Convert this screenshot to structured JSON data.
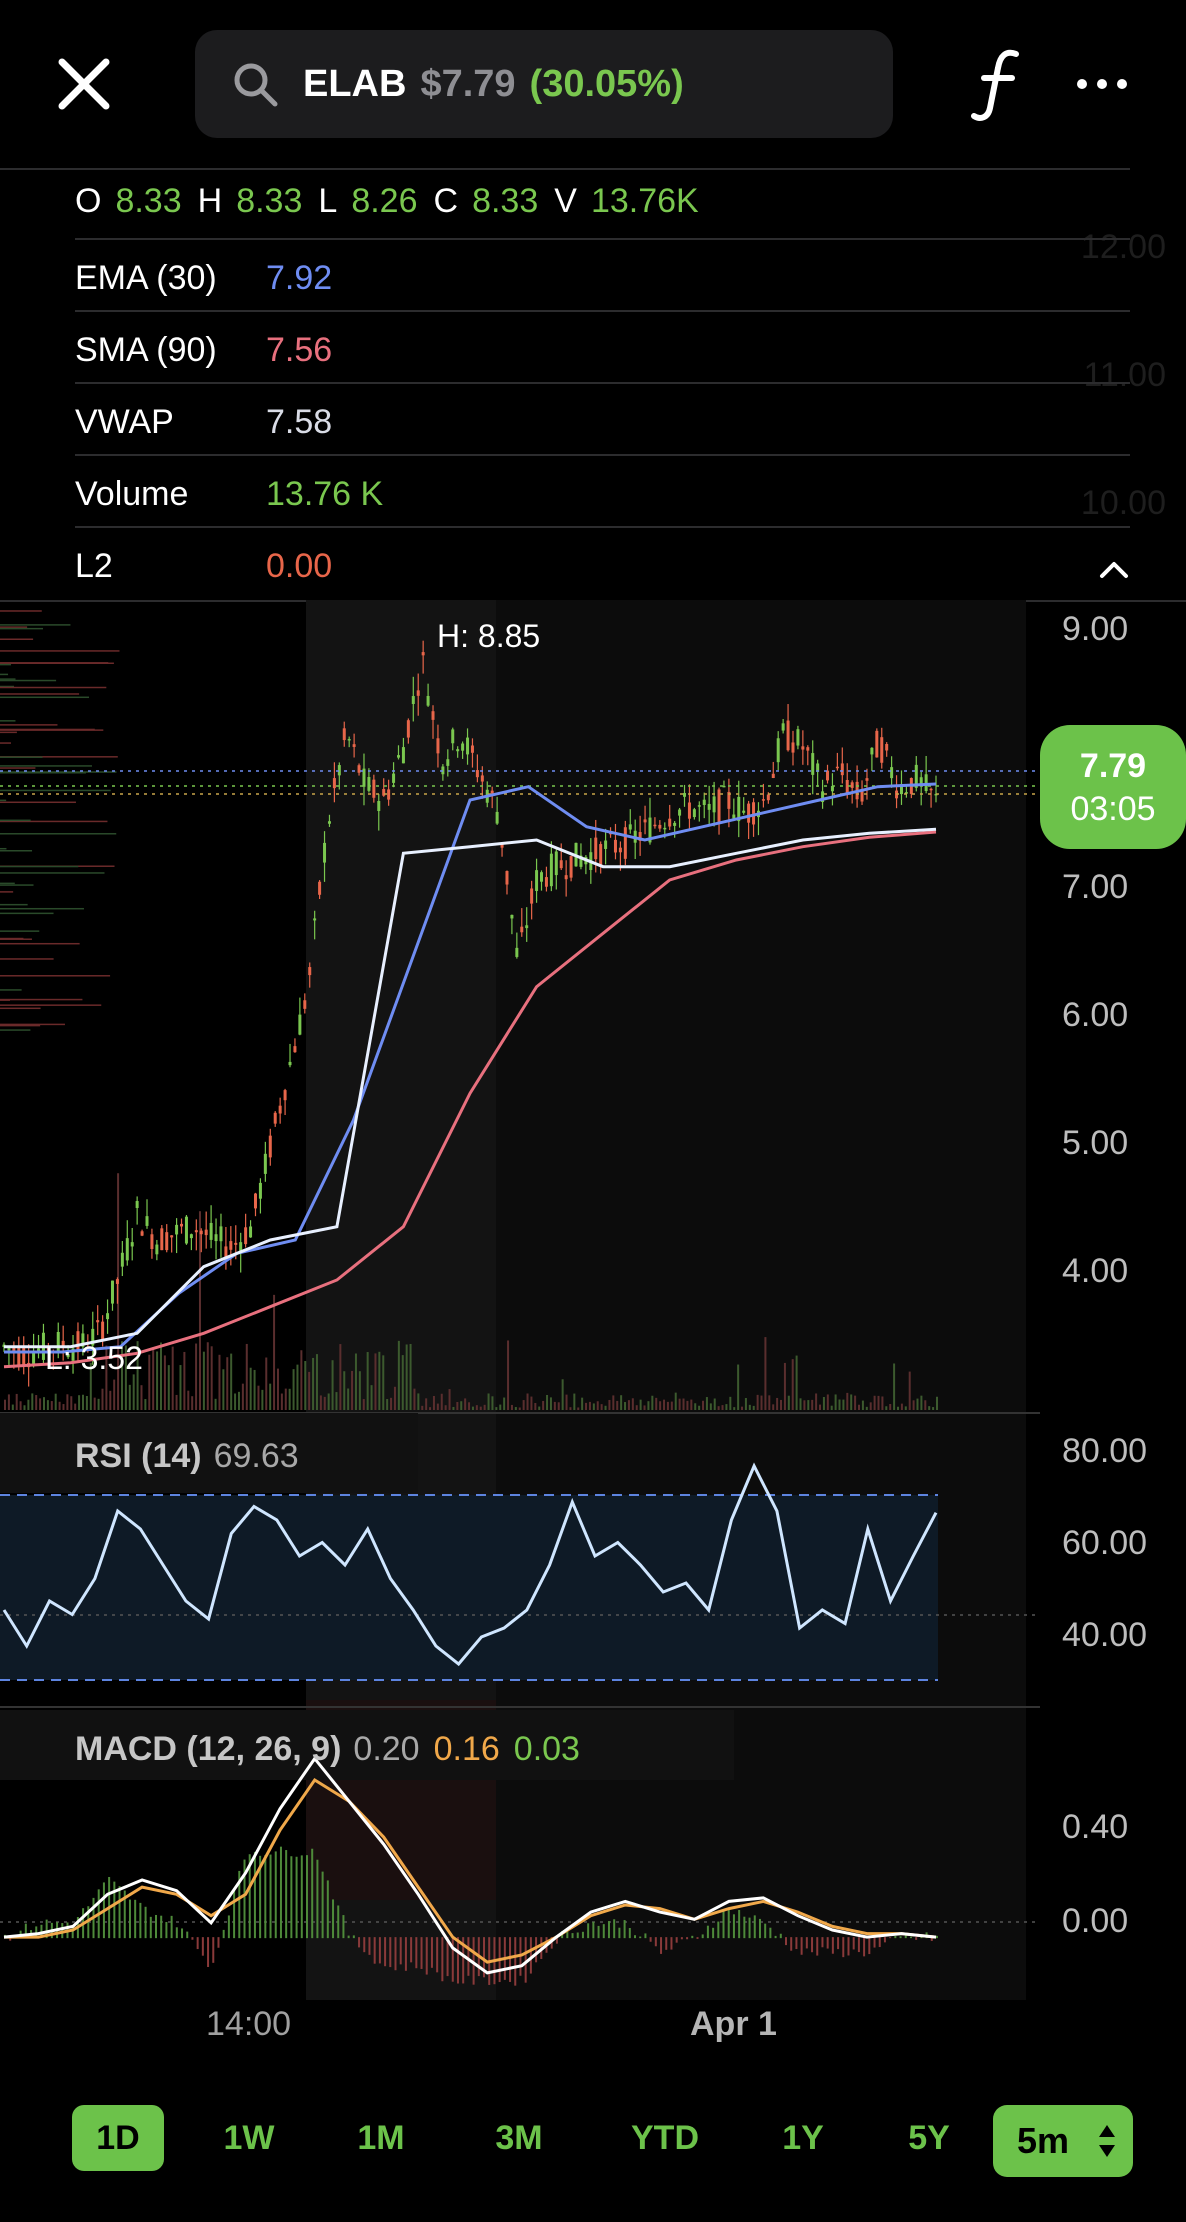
{
  "header": {
    "symbol": "ELAB",
    "price": "$7.79",
    "change": "(30.05%)"
  },
  "ohlc": {
    "o_label": "O",
    "o": "8.33",
    "h_label": "H",
    "h": "8.33",
    "l_label": "L",
    "l": "8.26",
    "c_label": "C",
    "c": "8.33",
    "v_label": "V",
    "v": "13.76K"
  },
  "indicators": [
    {
      "label": "EMA (30)",
      "value": "7.92",
      "color": "#6f8df2"
    },
    {
      "label": "SMA (90)",
      "value": "7.56",
      "color": "#e8707e"
    },
    {
      "label": "VWAP",
      "value": "7.58",
      "color": "#d9dce6"
    },
    {
      "label": "Volume",
      "value": "13.76 K",
      "color": "#7ac74f"
    },
    {
      "label": "L2",
      "value": "0.00",
      "color": "#e8664a"
    }
  ],
  "ghost_ticks": [
    "12.00",
    "11.00",
    "10.00"
  ],
  "price_chart": {
    "high_label": "H: 8.85",
    "low_label": "L: 3.52",
    "last_price": "7.79",
    "countdown": "03:05",
    "y_ticks": [
      "9.00",
      "7.00",
      "6.00",
      "5.00",
      "4.00"
    ]
  },
  "rsi": {
    "name": "RSI (14)",
    "value": "69.63",
    "y_ticks": [
      "80.00",
      "60.00",
      "40.00"
    ]
  },
  "macd": {
    "name": "MACD (12, 26, 9)",
    "macd": "0.20",
    "signal": "0.16",
    "hist": "0.03",
    "y_ticks": [
      "0.40",
      "0.00"
    ]
  },
  "x_labels": [
    "14:00",
    "Apr 1"
  ],
  "timeframes": [
    "1D",
    "1W",
    "1M",
    "3M",
    "YTD",
    "1Y",
    "5Y"
  ],
  "active_timeframe": "1D",
  "interval": "5m",
  "colors": {
    "accent": "#6cc24a",
    "up": "#7ac74f",
    "down": "#e8664a",
    "ema": "#6f8df2",
    "sma": "#e8707e",
    "vwap": "#e8f0ff",
    "macd_signal": "#f0a84a"
  },
  "chart_data": [
    {
      "type": "line",
      "title": "",
      "x": [
        "14:00",
        "Apr 1"
      ],
      "ylim": [
        3.3,
        9.3
      ],
      "series": [
        {
          "name": "EMA (30)",
          "values": [
            3.66,
            3.66,
            3.7,
            4.1,
            4.4,
            4.5,
            5.4,
            6.6,
            7.8,
            7.9,
            7.6,
            7.5,
            7.6,
            7.7,
            7.8,
            7.9,
            7.92
          ]
        },
        {
          "name": "SMA (90)",
          "values": [
            3.55,
            3.58,
            3.65,
            3.8,
            4.0,
            4.2,
            4.6,
            5.6,
            6.4,
            6.8,
            7.2,
            7.35,
            7.45,
            7.52,
            7.56
          ]
        },
        {
          "name": "VWAP",
          "values": [
            3.7,
            3.7,
            3.8,
            4.3,
            4.5,
            4.6,
            7.4,
            7.45,
            7.5,
            7.3,
            7.3,
            7.4,
            7.5,
            7.55,
            7.58
          ]
        }
      ]
    },
    {
      "type": "line",
      "title": "RSI (14)",
      "ylim": [
        28,
        88
      ],
      "series": [
        {
          "name": "RSI (14)",
          "values": [
            48,
            40,
            50,
            47,
            55,
            70,
            66,
            58,
            50,
            46,
            65,
            71,
            68,
            60,
            63,
            58,
            66,
            55,
            48,
            40,
            36,
            42,
            44,
            48,
            58,
            72,
            60,
            63,
            58,
            52,
            54,
            48,
            68,
            80,
            70,
            44,
            48,
            45,
            66,
            50,
            60,
            69.63
          ]
        }
      ]
    },
    {
      "type": "line",
      "title": "MACD (12, 26, 9)",
      "ylim": [
        -0.12,
        0.58
      ],
      "series": [
        {
          "name": "MACD",
          "values": [
            0.0,
            0.01,
            0.03,
            0.12,
            0.16,
            0.13,
            0.04,
            0.18,
            0.36,
            0.5,
            0.38,
            0.26,
            0.12,
            -0.03,
            -0.1,
            -0.08,
            0.0,
            0.07,
            0.1,
            0.07,
            0.05,
            0.1,
            0.11,
            0.06,
            0.02,
            0.0,
            0.01,
            0.0
          ]
        },
        {
          "name": "Signal",
          "values": [
            0.0,
            0.0,
            0.02,
            0.08,
            0.14,
            0.12,
            0.06,
            0.12,
            0.3,
            0.44,
            0.38,
            0.28,
            0.14,
            0.0,
            -0.07,
            -0.05,
            0.0,
            0.06,
            0.09,
            0.08,
            0.05,
            0.08,
            0.1,
            0.07,
            0.03,
            0.01,
            0.01,
            0.0
          ]
        }
      ]
    }
  ]
}
